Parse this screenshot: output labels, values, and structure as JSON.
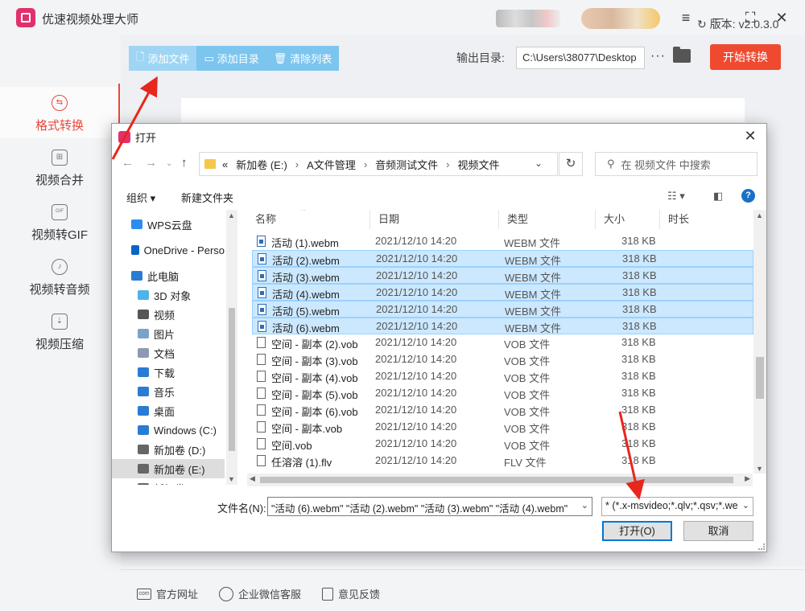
{
  "app": {
    "title": "优速视频处理大师"
  },
  "window_controls": {
    "menu": "≡",
    "minimize": "—",
    "maximize": "⛶",
    "close": "✕"
  },
  "sidebar": {
    "items": [
      {
        "label": "格式转换",
        "icon": "format-convert-icon",
        "glyph": "⇆",
        "active": true
      },
      {
        "label": "视频合并",
        "icon": "video-merge-icon",
        "glyph": "⊞"
      },
      {
        "label": "视频转GIF",
        "icon": "video-gif-icon",
        "glyph": "GIF"
      },
      {
        "label": "视频转音频",
        "icon": "video-audio-icon",
        "glyph": "♪"
      },
      {
        "label": "视频压缩",
        "icon": "video-compress-icon",
        "glyph": "⇣"
      }
    ]
  },
  "toolbar": {
    "add_file": "添加文件",
    "add_folder": "添加目录",
    "clear_list": "清除列表"
  },
  "output": {
    "label": "输出目录:",
    "path": "C:\\Users\\38077\\Desktop",
    "more": "···"
  },
  "start_button": "开始转换",
  "footer": {
    "website": "官方网址",
    "wechat": "企业微信客服",
    "feedback": "意见反馈",
    "version_label": "版本:",
    "version": "v2.0.3.0"
  },
  "dialog": {
    "title": "打开",
    "close": "✕",
    "address": {
      "prefix": "«",
      "parts": [
        "新加卷 (E:)",
        "A文件管理",
        "音频测试文件",
        "视频文件"
      ],
      "sep": "›"
    },
    "search_placeholder": "在 视频文件 中搜索",
    "organize": "组织 ▾",
    "new_folder": "新建文件夹",
    "help": "?",
    "nav_items": [
      {
        "label": "WPS云盘",
        "icon": "cloud-icon",
        "color": "#2d8cf0"
      },
      {
        "label": "OneDrive - Perso",
        "icon": "onedrive-icon",
        "color": "#0a64c8"
      },
      {
        "label": "此电脑",
        "icon": "computer-icon",
        "color": "#2a7bd4"
      },
      {
        "label": "3D 对象",
        "icon": "3d-objects-icon",
        "color": "#4fb3e8"
      },
      {
        "label": "视频",
        "icon": "videos-icon",
        "color": "#555"
      },
      {
        "label": "图片",
        "icon": "pictures-icon",
        "color": "#7aa3c9"
      },
      {
        "label": "文档",
        "icon": "documents-icon",
        "color": "#8a9bb0"
      },
      {
        "label": "下载",
        "icon": "downloads-icon",
        "color": "#2a7bd4"
      },
      {
        "label": "音乐",
        "icon": "music-icon",
        "color": "#2a7bd4"
      },
      {
        "label": "桌面",
        "icon": "desktop-icon",
        "color": "#2a7bd4"
      },
      {
        "label": "Windows (C:)",
        "icon": "drive-c-icon",
        "color": "#2a7bd4"
      },
      {
        "label": "新加卷 (D:)",
        "icon": "drive-d-icon",
        "color": "#666"
      },
      {
        "label": "新加卷 (E:)",
        "icon": "drive-e-icon",
        "color": "#666",
        "selected": true
      },
      {
        "label": "新加卷 (F:)",
        "icon": "drive-f-icon",
        "color": "#666"
      }
    ],
    "columns": {
      "name": "名称",
      "date": "日期",
      "type": "类型",
      "size": "大小",
      "duration": "时长"
    },
    "files": [
      {
        "name": "活动 (1).webm",
        "date": "2021/12/10 14:20",
        "type": "WEBM 文件",
        "size": "318 KB",
        "kind": "webm",
        "selected": false
      },
      {
        "name": "活动 (2).webm",
        "date": "2021/12/10 14:20",
        "type": "WEBM 文件",
        "size": "318 KB",
        "kind": "webm",
        "selected": true
      },
      {
        "name": "活动 (3).webm",
        "date": "2021/12/10 14:20",
        "type": "WEBM 文件",
        "size": "318 KB",
        "kind": "webm",
        "selected": true
      },
      {
        "name": "活动 (4).webm",
        "date": "2021/12/10 14:20",
        "type": "WEBM 文件",
        "size": "318 KB",
        "kind": "webm",
        "selected": true
      },
      {
        "name": "活动 (5).webm",
        "date": "2021/12/10 14:20",
        "type": "WEBM 文件",
        "size": "318 KB",
        "kind": "webm",
        "selected": true
      },
      {
        "name": "活动 (6).webm",
        "date": "2021/12/10 14:20",
        "type": "WEBM 文件",
        "size": "318 KB",
        "kind": "webm",
        "selected": true
      },
      {
        "name": "空间 - 副本 (2).vob",
        "date": "2021/12/10 14:20",
        "type": "VOB 文件",
        "size": "318 KB",
        "kind": "vob",
        "selected": false
      },
      {
        "name": "空间 - 副本 (3).vob",
        "date": "2021/12/10 14:20",
        "type": "VOB 文件",
        "size": "318 KB",
        "kind": "vob",
        "selected": false
      },
      {
        "name": "空间 - 副本 (4).vob",
        "date": "2021/12/10 14:20",
        "type": "VOB 文件",
        "size": "318 KB",
        "kind": "vob",
        "selected": false
      },
      {
        "name": "空间 - 副本 (5).vob",
        "date": "2021/12/10 14:20",
        "type": "VOB 文件",
        "size": "318 KB",
        "kind": "vob",
        "selected": false
      },
      {
        "name": "空间 - 副本 (6).vob",
        "date": "2021/12/10 14:20",
        "type": "VOB 文件",
        "size": "318 KB",
        "kind": "vob",
        "selected": false
      },
      {
        "name": "空间 - 副本.vob",
        "date": "2021/12/10 14:20",
        "type": "VOB 文件",
        "size": "318 KB",
        "kind": "vob",
        "selected": false
      },
      {
        "name": "空间.vob",
        "date": "2021/12/10 14:20",
        "type": "VOB 文件",
        "size": "318 KB",
        "kind": "vob",
        "selected": false
      },
      {
        "name": "任溶溶 (1).flv",
        "date": "2021/12/10 14:20",
        "type": "FLV 文件",
        "size": "318 KB",
        "kind": "flv",
        "selected": false
      }
    ],
    "filename_label": "文件名(N):",
    "filename_value": "\"活动 (6).webm\" \"活动 (2).webm\" \"活动 (3).webm\" \"活动 (4).webm\"",
    "filetype_value": "* (*.x-msvideo;*.qlv;*.qsv;*.we",
    "open_button": "打开(O)",
    "cancel_button": "取消"
  },
  "colors": {
    "accent": "#ef4a2f",
    "toolbar": "#7bc5ef",
    "selection": "#cce8ff"
  }
}
